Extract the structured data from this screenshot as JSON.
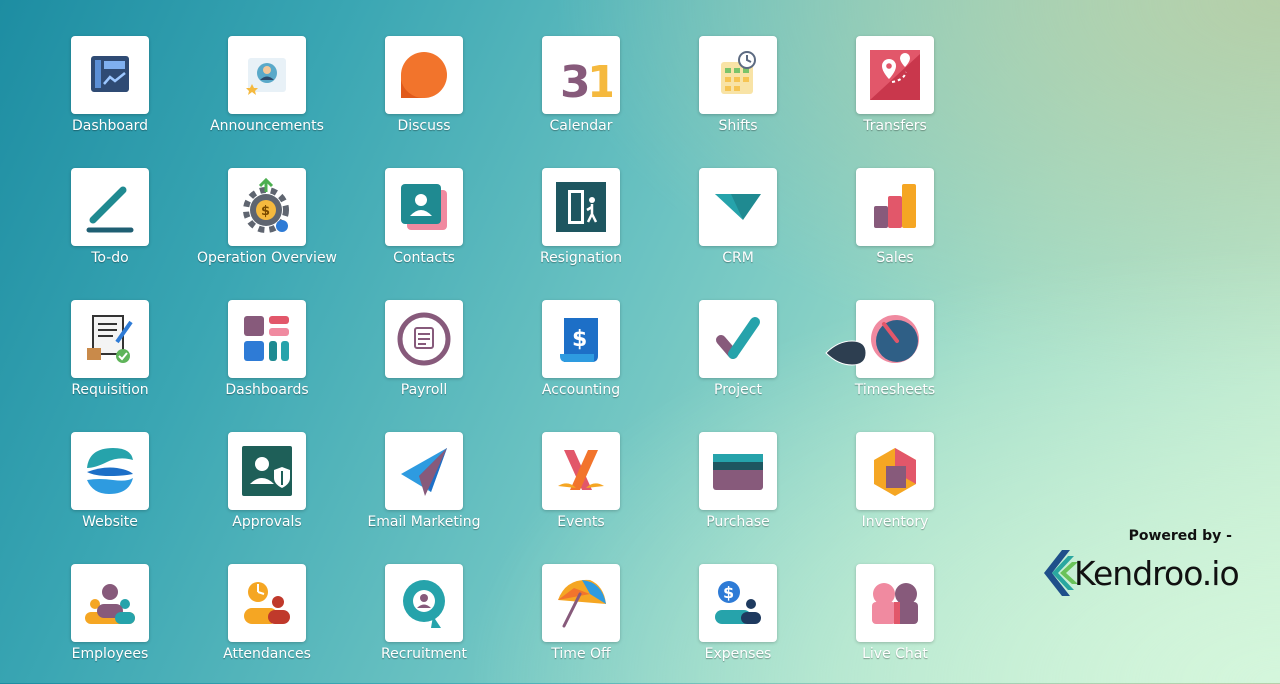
{
  "apps": [
    {
      "label": "Dashboard",
      "icon": "dashboard-icon"
    },
    {
      "label": "Announcements",
      "icon": "announcements-icon"
    },
    {
      "label": "Discuss",
      "icon": "discuss-icon"
    },
    {
      "label": "Calendar",
      "icon": "calendar-icon",
      "glyph": "31"
    },
    {
      "label": "Shifts",
      "icon": "shifts-icon"
    },
    {
      "label": "Transfers",
      "icon": "transfers-icon"
    },
    {
      "label": "To-do",
      "icon": "todo-icon"
    },
    {
      "label": "Operation Overview",
      "icon": "operation-overview-icon"
    },
    {
      "label": "Contacts",
      "icon": "contacts-icon"
    },
    {
      "label": "Resignation",
      "icon": "resignation-icon"
    },
    {
      "label": "CRM",
      "icon": "crm-icon"
    },
    {
      "label": "Sales",
      "icon": "sales-icon"
    },
    {
      "label": "Requisition",
      "icon": "requisition-icon"
    },
    {
      "label": "Dashboards",
      "icon": "dashboards-icon"
    },
    {
      "label": "Payroll",
      "icon": "payroll-icon"
    },
    {
      "label": "Accounting",
      "icon": "accounting-icon",
      "glyph": "$"
    },
    {
      "label": "Project",
      "icon": "project-icon"
    },
    {
      "label": "Timesheets",
      "icon": "timesheets-icon"
    },
    {
      "label": "Website",
      "icon": "website-icon"
    },
    {
      "label": "Approvals",
      "icon": "approvals-icon"
    },
    {
      "label": "Email Marketing",
      "icon": "email-marketing-icon"
    },
    {
      "label": "Events",
      "icon": "events-icon"
    },
    {
      "label": "Purchase",
      "icon": "purchase-icon"
    },
    {
      "label": "Inventory",
      "icon": "inventory-icon"
    },
    {
      "label": "Employees",
      "icon": "employees-icon"
    },
    {
      "label": "Attendances",
      "icon": "attendances-icon"
    },
    {
      "label": "Recruitment",
      "icon": "recruitment-icon"
    },
    {
      "label": "Time Off",
      "icon": "time-off-icon"
    },
    {
      "label": "Expenses",
      "icon": "expenses-icon",
      "glyph": "$"
    },
    {
      "label": "Live Chat",
      "icon": "live-chat-icon"
    }
  ],
  "branding": {
    "powered_by": "Powered by -",
    "name": "Kendroo.io",
    "logo_icon": "kendroo-logo-icon"
  },
  "colors": {
    "odoo_purple": "#875a7b",
    "teal": "#1f8a91",
    "orange": "#f2742c",
    "blue": "#2e7bd6"
  }
}
